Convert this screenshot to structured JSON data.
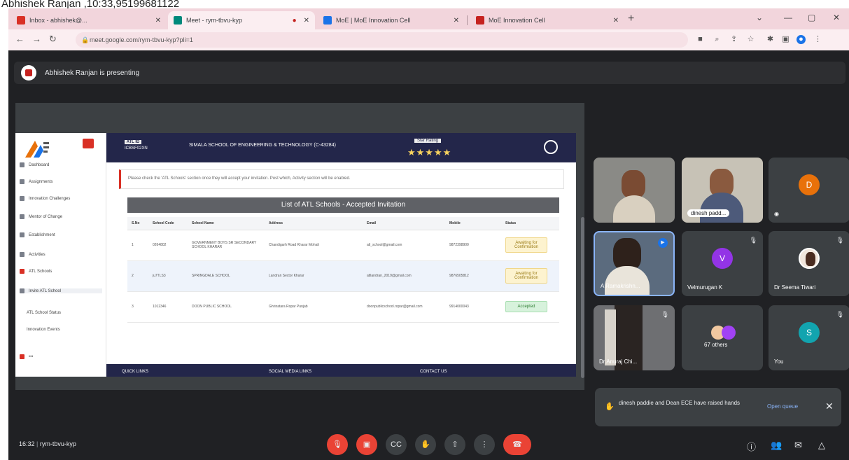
{
  "caption": "Abhishek Ranjan ,10:33,95199681122",
  "browser": {
    "tabs": [
      {
        "label": "Inbox - abhishek@...",
        "color": "#d93025"
      },
      {
        "label": "Meet - rym-tbvu-kyp",
        "color": "#00897b"
      },
      {
        "label": "MoE | MoE Innovation Cell",
        "color": "#1a73e8"
      },
      {
        "label": "MoE Innovation Cell",
        "color": "#c5221f"
      }
    ],
    "url": "meet.google.com/rym-tbvu-kyp?pli=1",
    "new_tab": "+",
    "window_controls": [
      "⌄",
      "—",
      "▢",
      "✕"
    ]
  },
  "meet": {
    "presenter_text": "Abhishek Ranjan is presenting",
    "meeting_time": "16:32",
    "meeting_code": "rym-tbvu-kyp",
    "participants": [
      {
        "name": "",
        "type": "video"
      },
      {
        "name": "dinesh padd...",
        "type": "video"
      },
      {
        "name": "",
        "initial": "D",
        "color": "#e8710a",
        "type": "avatar"
      },
      {
        "name": "A Ramakrishn...",
        "type": "video"
      },
      {
        "name": "Velmurugan K",
        "initial": "V",
        "color": "#9334e6",
        "type": "avatar"
      },
      {
        "name": "Dr Seema Tiwari",
        "type": "photo"
      },
      {
        "name": "Dr.Anuraj Chi...",
        "type": "video"
      },
      {
        "name": "67 others",
        "type": "group"
      },
      {
        "name": "You",
        "initial": "S",
        "color": "#12a4af",
        "type": "avatar"
      }
    ],
    "toast": {
      "text": "dinesh paddie and Dean ECE have raised hands",
      "action": "Open queue",
      "close": "✕"
    }
  },
  "site": {
    "school_code_label": "ATL ID",
    "school_code": "ICBSF02XN",
    "school_name": "SIMALA SCHOOL OF ENGINEERING & TECHNOLOGY (C-43284)",
    "rating_label": "Star Rating",
    "stars": "★★★★★",
    "notice": "Please check the 'ATL Schools' section once they will accept your invitation. Post which, Activity section will be enabled.",
    "list_title": "List of ATL Schools - Accepted Invitation",
    "columns": [
      "S.No",
      "School Code",
      "School Name",
      "Address",
      "Email",
      "Mobile",
      "Status"
    ],
    "rows": [
      [
        "1",
        "0264802",
        "GOVERNMENT BOYS SR SECONDARY SCHOOL KHARAR",
        "Chandigarh Road Kharar Mohali",
        "atl_school@gmail.com",
        "9872398900",
        "Awaiting for Confirmation"
      ],
      [
        "2",
        "ju7TLS3",
        "SPRINGDALE SCHOOL",
        "Landran Sector Kharar",
        "atllandran_2019@gmail.com",
        "9876505812",
        "Awaiting for Confirmation"
      ],
      [
        "3",
        "1012346",
        "DOON PUBLIC SCHOOL",
        "Ghrinatara Ropar Punjab",
        "doonpublicschool.ropar@gmail.com",
        "9914000043",
        "Accepted"
      ]
    ],
    "sidebar": [
      "Dashboard",
      "Assignments",
      "Innovation Challenges",
      "Mentor of Change",
      "Establishment",
      "Activities",
      "ATL Schools",
      "Invite ATL School",
      "ATL School Status",
      "Innovation Events"
    ],
    "footer": [
      "QUICK LINKS",
      "SOCIAL MEDIA LINKS",
      "CONTACT US"
    ]
  }
}
